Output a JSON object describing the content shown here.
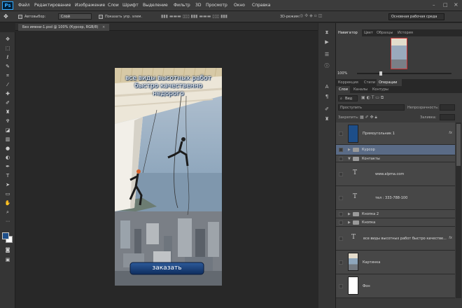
{
  "app": {
    "logo": "Ps",
    "accent": "#31a8ff"
  },
  "menu": [
    "Файл",
    "Редактирование",
    "Изображение",
    "Слои",
    "Шрифт",
    "Выделение",
    "Фильтр",
    "3D",
    "Просмотр",
    "Окно",
    "Справка"
  ],
  "options_bar": {
    "autoselect_label": "Автовыбор:",
    "autoselect_value": "Слой",
    "show_controls_label": "Показать упр. элем.",
    "mode_3d": "3D-режим:",
    "workspace": "Основная рабочая среда"
  },
  "document": {
    "tab_title": "Без имени-1.psd @ 100% (Курсор, RGB/8)"
  },
  "artwork": {
    "headline_line1": "все виды высотных работ",
    "headline_line2": "быстро качественно",
    "headline_line3": "недорого",
    "button_label": "заказать"
  },
  "navigator": {
    "tabs": [
      "Навигатор",
      "Цвет",
      "Образцы",
      "История"
    ],
    "zoom": "100%"
  },
  "adjust_tabs": [
    "Коррекция",
    "Стили",
    "Операции"
  ],
  "layers_panel": {
    "tabs": [
      "Слои",
      "Каналы",
      "Контуры"
    ],
    "filter_kind": "Вид",
    "blend_mode": "Проступить",
    "opacity_label": "Непрозрачность:",
    "lock_label": "Закрепить:",
    "fill_label": "Заливка:",
    "layers": [
      {
        "name": "Прямоугольник 1",
        "kind": "shape",
        "fx": "fx"
      },
      {
        "name": "Курсор",
        "kind": "group",
        "open": false
      },
      {
        "name": "Контакты",
        "kind": "group",
        "open": true
      },
      {
        "name": "www.alpma.com",
        "kind": "text",
        "indent": true
      },
      {
        "name": "тел : 333-788-100",
        "kind": "text",
        "indent": true
      },
      {
        "name": "Кнопка 2",
        "kind": "group",
        "open": false
      },
      {
        "name": "Кнопка",
        "kind": "group",
        "open": false
      },
      {
        "name": "все виды высотных работ быстро качестве...",
        "kind": "text",
        "fx": "fx"
      },
      {
        "name": "Картинка",
        "kind": "image"
      },
      {
        "name": "Фон",
        "kind": "fill"
      }
    ]
  },
  "colors": {
    "foreground": "#1d4e89",
    "background": "#ffffff"
  }
}
